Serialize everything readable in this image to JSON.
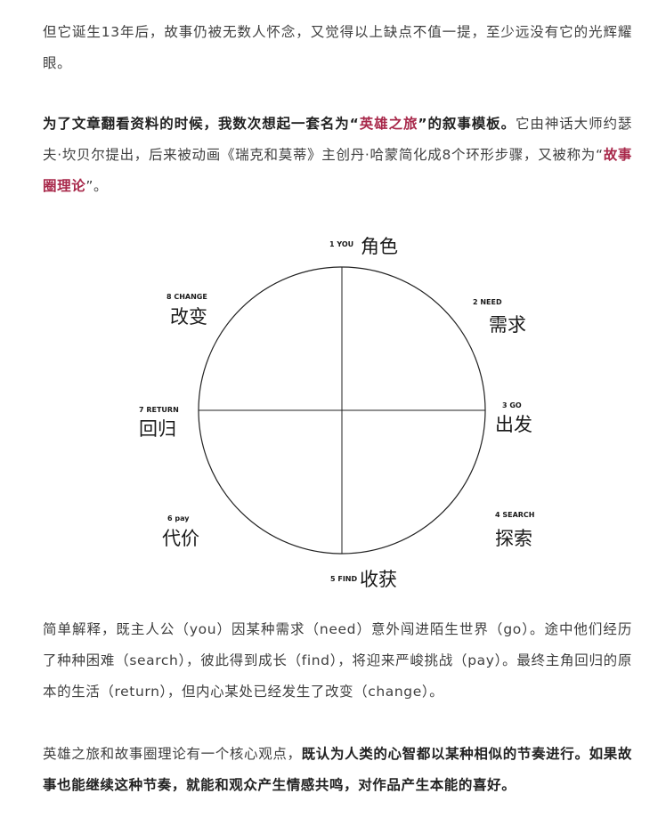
{
  "paragraph1": {
    "text": "但它诞生13年后，故事仍被无数人怀念，又觉得以上缺点不值一提，至少远没有它的光辉耀眼。"
  },
  "paragraph2": {
    "bold_intro": "为了文章翻看资料的时候，我数次想起一套名为“",
    "highlight1": "英雄之旅",
    "bold_mid": "”的叙事模板。",
    "text": "它由神话大师约瑟夫·坎贝尔提出，后来被动画《瑞克和莫蒂》主创丹·哈蒙简化成8个环形步骤，又被称为“",
    "highlight2": "故事圈理论",
    "end": "”。"
  },
  "diagram": {
    "steps": [
      {
        "small": "1 YOU",
        "big": "角色"
      },
      {
        "small": "2 NEED",
        "big": "需求"
      },
      {
        "small": "3 GO",
        "big": "出发"
      },
      {
        "small": "4 SEARCH",
        "big": "探索"
      },
      {
        "small": "5 FIND",
        "big": "收获"
      },
      {
        "small": "6 pay",
        "big": "代价"
      },
      {
        "small": "7 RETURN",
        "big": "回归"
      },
      {
        "small": "8 CHANGE",
        "big": "改变"
      }
    ]
  },
  "paragraph3": {
    "text": "简单解释，既主人公（you）因某种需求（need）意外闯进陌生世界（go）。途中他们经历了种种困难（search），彼此得到成长（find），将迎来严峻挑战（pay）。最终主角回归的原本的生活（return），但内心某处已经发生了改变（change）。"
  },
  "paragraph4": {
    "text": "英雄之旅和故事圈理论有一个核心观点，",
    "bold": "既认为人类的心智都以某种相似的节奏进行。如果故事也能继续这种节奏，就能和观众产生情感共鸣，对作品产生本能的喜好。"
  }
}
